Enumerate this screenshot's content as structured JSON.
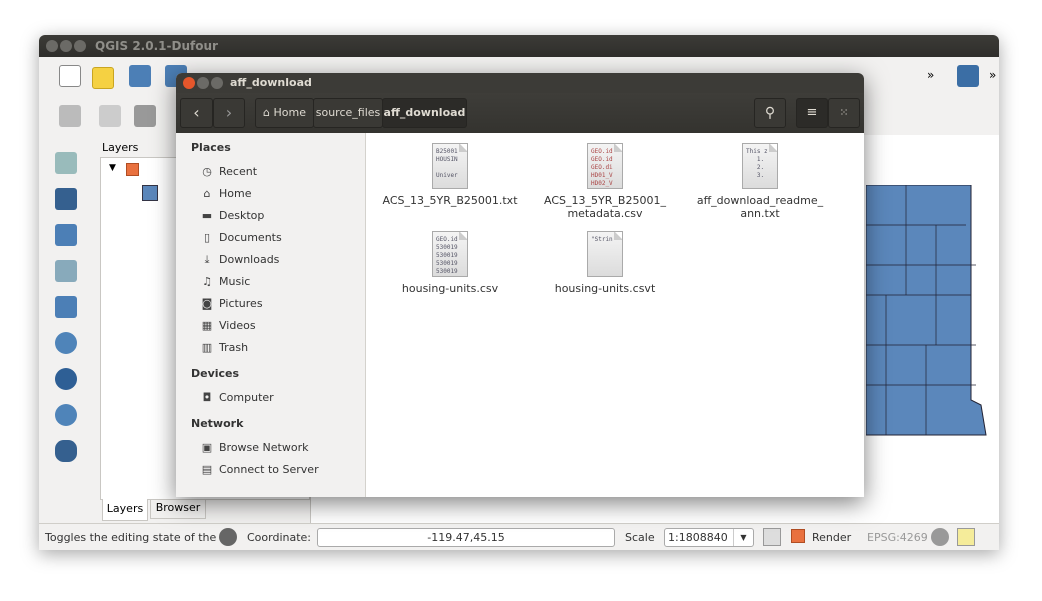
{
  "qgis": {
    "title": "QGIS 2.0.1-Dufour",
    "layers_panel": {
      "title": "Layers",
      "tabs": [
        {
          "label": "Layers"
        },
        {
          "label": "Browser"
        }
      ]
    },
    "status": {
      "message": "Toggles the editing state of the cu",
      "coordinate_label": "Coordinate:",
      "coordinate_value": "-119.47,45.15",
      "scale_label": "Scale",
      "scale_value": "1:1808840",
      "render_label": "Render",
      "render_checked": true,
      "crs": "EPSG:4269"
    },
    "colors": {
      "map_fill": "#5b87bb",
      "accent": "#e9713f"
    }
  },
  "file_manager": {
    "title": "aff_download",
    "breadcrumb": [
      {
        "label": "Home",
        "icon": "home-icon"
      },
      {
        "label": "source_files"
      },
      {
        "label": "aff_download"
      }
    ],
    "sidebar": {
      "sections": [
        {
          "title": "Places",
          "items": [
            {
              "label": "Recent",
              "icon": "clock-icon"
            },
            {
              "label": "Home",
              "icon": "home-icon"
            },
            {
              "label": "Desktop",
              "icon": "folder-icon"
            },
            {
              "label": "Documents",
              "icon": "document-icon"
            },
            {
              "label": "Downloads",
              "icon": "download-icon"
            },
            {
              "label": "Music",
              "icon": "music-icon"
            },
            {
              "label": "Pictures",
              "icon": "camera-icon"
            },
            {
              "label": "Videos",
              "icon": "film-icon"
            },
            {
              "label": "Trash",
              "icon": "trash-icon"
            }
          ]
        },
        {
          "title": "Devices",
          "items": [
            {
              "label": "Computer",
              "icon": "drive-icon"
            }
          ]
        },
        {
          "title": "Network",
          "items": [
            {
              "label": "Browse Network",
              "icon": "network-icon"
            },
            {
              "label": "Connect to Server",
              "icon": "server-icon"
            }
          ]
        }
      ]
    },
    "files": [
      {
        "name": "ACS_13_5YR_B25001.txt",
        "preview": "B25001\nHOUSIN\n\nUniver"
      },
      {
        "name": "ACS_13_5YR_B25001_\nmetadata.csv",
        "preview": "GEO.id\nGEO.id\nGEO.di\nHD01_V\nHD02_V"
      },
      {
        "name": "aff_download_readme_\nann.txt",
        "preview": "This z\n   1.\n   2.\n   3."
      },
      {
        "name": "housing-units.csv",
        "preview": "GEO.id\n530019\n530019\n530019\n530019"
      },
      {
        "name": "housing-units.csvt",
        "preview": "\"Strin"
      }
    ]
  }
}
